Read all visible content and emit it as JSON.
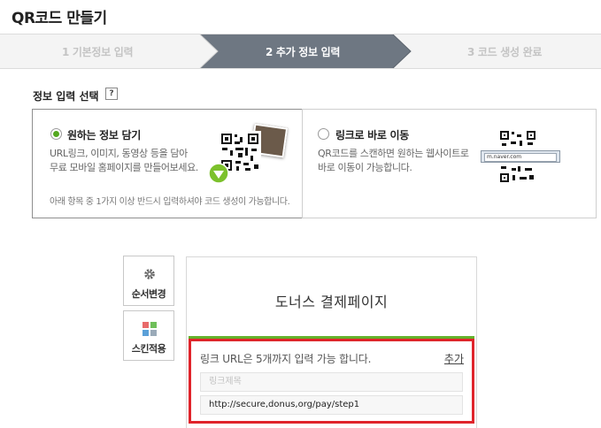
{
  "page": {
    "title": "QR코드 만들기"
  },
  "steps": [
    {
      "label": "1 기본정보 입력",
      "state": "done"
    },
    {
      "label": "2 추가 정보 입력",
      "state": "active"
    },
    {
      "label": "3 코드 생성 완료",
      "state": "pending"
    }
  ],
  "section": {
    "title": "정보 입력 선택",
    "help": "?"
  },
  "options": [
    {
      "title": "원하는 정보 담기",
      "selected": true,
      "desc1": "URL링크, 이미지, 동영상 등을 담아",
      "desc2": "무료 모바일 홈페이지를 만들어보세요.",
      "note": "아래 항목 중 1가지 이상 반드시 입력하셔야 코드 생성이 가능합니다."
    },
    {
      "title": "링크로 바로 이동",
      "selected": false,
      "desc1": "QR코드를 스캔하면 원하는 웹사이트로",
      "desc2": "바로 이동이 가능합니다.",
      "url_sample": "m.naver.com"
    }
  ],
  "side_buttons": [
    {
      "label": "순서변경",
      "icon": "gear-icon"
    },
    {
      "label": "스킨적용",
      "icon": "skin-grid-icon"
    }
  ],
  "preview": {
    "title": "도너스 결제페이지",
    "link_info": "링크 URL은 5개까지 입력 가능 합니다.",
    "add_label": "추가",
    "link_title_placeholder": "링크제목",
    "link_url_value": "http://secure,donus,org/pay/step1"
  },
  "colors": {
    "accent_green": "#65b22c",
    "step_active": "#6e7782",
    "highlight_red": "#e0242b"
  }
}
